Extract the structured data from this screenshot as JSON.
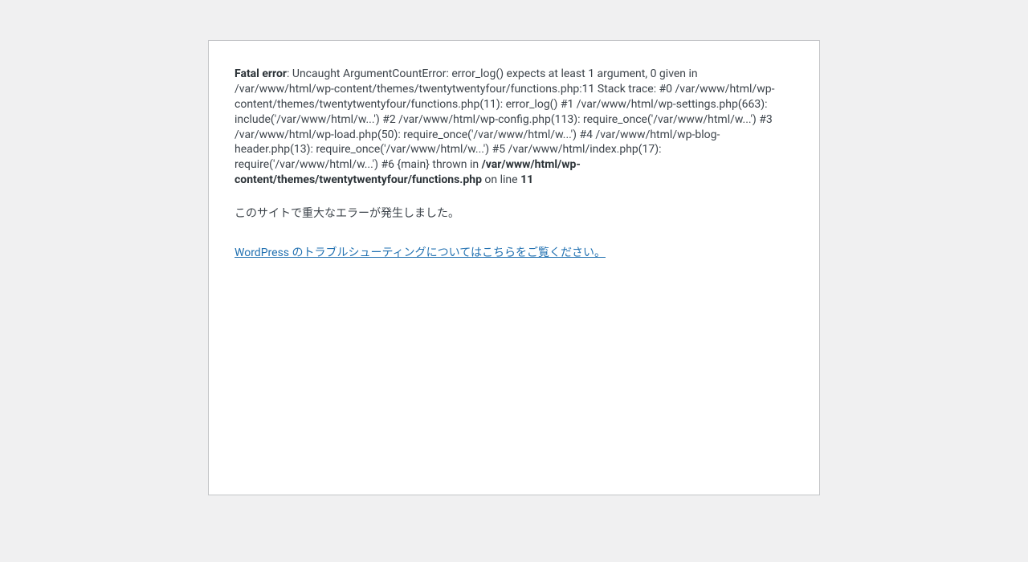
{
  "error": {
    "label": "Fatal error",
    "sep": ": ",
    "message": "Uncaught ArgumentCountError: error_log() expects at least 1 argument, 0 given in /var/www/html/wp-content/themes/twentytwentyfour/functions.php:11 Stack trace: #0 /var/www/html/wp-content/themes/twentytwentyfour/functions.php(11): error_log() #1 /var/www/html/wp-settings.php(663): include('/var/www/html/w...') #2 /var/www/html/wp-config.php(113): require_once('/var/www/html/w...') #3 /var/www/html/wp-load.php(50): require_once('/var/www/html/w...') #4 /var/www/html/wp-blog-header.php(13): require_once('/var/www/html/w...') #5 /var/www/html/index.php(17): require('/var/www/html/w...') #6 {main} thrown in ",
    "file": "/var/www/html/wp-content/themes/twentytwentyfour/functions.php",
    "online": " on line ",
    "line": "11"
  },
  "critical": "このサイトで重大なエラーが発生しました。",
  "help": {
    "text": "WordPress のトラブルシューティングについてはこちらをご覧ください。"
  }
}
